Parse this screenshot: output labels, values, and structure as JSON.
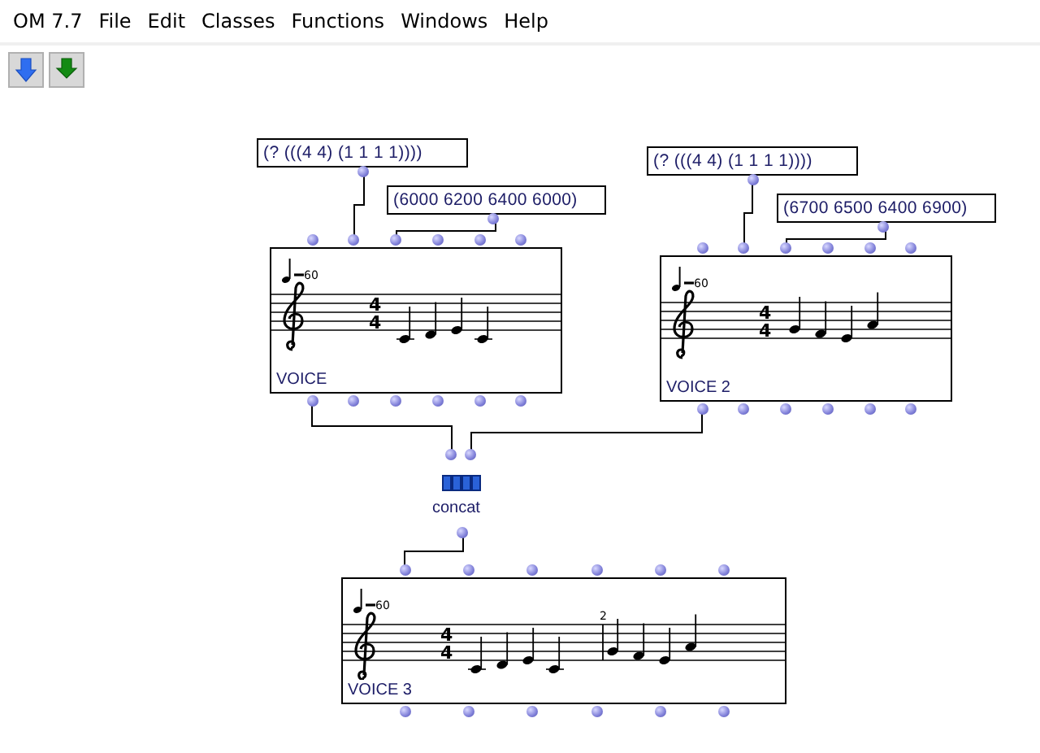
{
  "menu": [
    "OM 7.7",
    "File",
    "Edit",
    "Classes",
    "Functions",
    "Windows",
    "Help"
  ],
  "patch": {
    "boxes": [
      {
        "kind": "text",
        "value": "(? (((4 4) (1 1 1 1))))"
      },
      {
        "kind": "text",
        "value": "(6000 6200 6400 6000)"
      },
      {
        "kind": "voice",
        "label": "VOICE",
        "tempo": "60",
        "time_signature": [
          "4",
          "4"
        ]
      },
      {
        "kind": "text",
        "value": "(? (((4 4) (1 1 1 1))))"
      },
      {
        "kind": "text",
        "value": "(6700 6500 6400 6900)"
      },
      {
        "kind": "voice",
        "label": "VOICE 2",
        "tempo": "60",
        "time_signature": [
          "4",
          "4"
        ]
      },
      {
        "kind": "function",
        "label": "concat"
      },
      {
        "kind": "voice",
        "label": "VOICE 3",
        "tempo": "60",
        "time_signature": [
          "4",
          "4"
        ],
        "measure_number": "2"
      }
    ]
  }
}
